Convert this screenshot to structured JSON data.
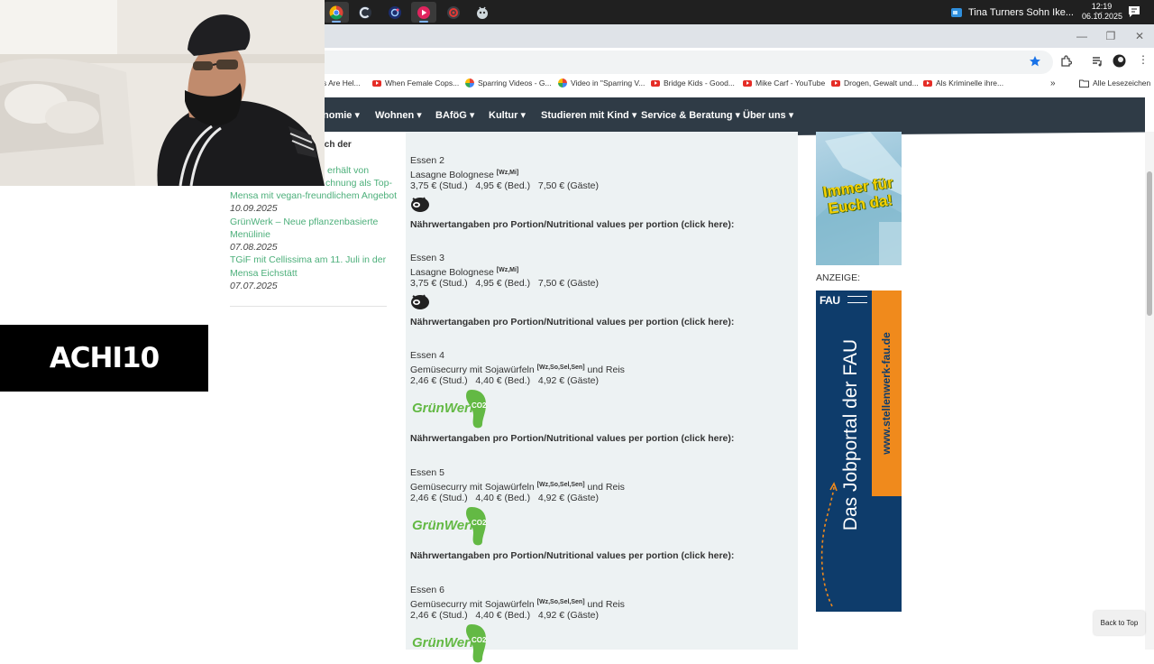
{
  "taskbar": {
    "media_title": "Tina Turners Sohn Ike...",
    "clock_time": "12:19",
    "clock_date": "06.10.2025"
  },
  "bookmarks": [
    {
      "label": "s Are Hel...",
      "icon": "youtube-icon"
    },
    {
      "label": "When Female Cops...",
      "icon": "youtube-icon"
    },
    {
      "label": "Sparring Videos - G...",
      "icon": "google-photos-icon"
    },
    {
      "label": "Video in \"Sparring V...",
      "icon": "google-photos-icon"
    },
    {
      "label": "Bridge Kids - Good...",
      "icon": "youtube-icon"
    },
    {
      "label": "Mike Carf - YouTube",
      "icon": "youtube-icon"
    },
    {
      "label": "Drogen, Gewalt und...",
      "icon": "youtube-icon"
    },
    {
      "label": "Als Kriminelle ihre...",
      "icon": "youtube-icon"
    }
  ],
  "bookmarks_all": "Alle Lesezeichen",
  "nav": {
    "items": [
      {
        "label": "nomie ▾"
      },
      {
        "label": "Wohnen ▾"
      },
      {
        "label": "BAföG ▾"
      },
      {
        "label": "Kultur ▾"
      },
      {
        "label": "Studieren mit Kind ▾"
      },
      {
        "label": "Service & Beratung ▾"
      },
      {
        "label": "Über uns ▾"
      }
    ]
  },
  "sidebar": {
    "partial_1": "ich der",
    "partial_2": "erhält von",
    "partial_3": "chnung als Top-",
    "news": [
      {
        "title": "Mensa mit vegan-freundlichem Angebot",
        "date": "10.09.2025"
      },
      {
        "title": "GrünWerk – Neue pflanzenbasierte Menülinie",
        "date": "07.08.2025"
      },
      {
        "title": "TGiF mit Cellissima am 11. Juli in der Mensa Eichstätt",
        "date": "07.07.2025"
      }
    ]
  },
  "menu": {
    "nutrition_label": "Nährwertangaben pro Portion/Nutritional values per portion (click here):",
    "dishes": [
      {
        "name": "Essen 2",
        "dish": "Lasagne Bolognese",
        "allergens": "[Wz,Mi]",
        "suffix": "",
        "price_student": "3,75 € (Stud.)",
        "price_staff": "4,95 € (Bed.)",
        "price_guest": "7,50 € (Gäste)",
        "badge": "pig-icon"
      },
      {
        "name": "Essen 3",
        "dish": "Lasagne Bolognese",
        "allergens": "[Wz,Mi]",
        "suffix": "",
        "price_student": "3,75 € (Stud.)",
        "price_staff": "4,95 € (Bed.)",
        "price_guest": "7,50 € (Gäste)",
        "badge": "pig-icon"
      },
      {
        "name": "Essen 4",
        "dish": "Gemüsecurry mit Sojawürfeln",
        "allergens": "[Wz,So,Sel,Sen]",
        "suffix": "und Reis",
        "price_student": "2,46 € (Stud.)",
        "price_staff": "4,40 € (Bed.)",
        "price_guest": "4,92 € (Gäste)",
        "badge": "gruenwerk-logo"
      },
      {
        "name": "Essen 5",
        "dish": "Gemüsecurry mit Sojawürfeln",
        "allergens": "[Wz,So,Sel,Sen]",
        "suffix": "und Reis",
        "price_student": "2,46 € (Stud.)",
        "price_staff": "4,40 € (Bed.)",
        "price_guest": "4,92 € (Gäste)",
        "badge": "gruenwerk-logo"
      },
      {
        "name": "Essen 6",
        "dish": "Gemüsecurry mit Sojawürfeln",
        "allergens": "[Wz,So,Sel,Sen]",
        "suffix": "und Reis",
        "price_student": "2,46 € (Stud.)",
        "price_staff": "4,40 € (Bed.)",
        "price_guest": "4,92 € (Gäste)",
        "badge": "gruenwerk-logo"
      }
    ]
  },
  "badges": {
    "gruenwerk_text": "GrünWerk",
    "co2_text": "CO2"
  },
  "ads": {
    "top_banner_text": "Immer für Euch da!",
    "label": "ANZEIGE:",
    "fau_logo": "FAU",
    "fau_headline": "Das Jobportal der FAU",
    "fau_url": "www.stellenwerk-fau.de"
  },
  "overlay": {
    "streamer_logo": "ACHI10"
  },
  "back_to_top": "Back to Top",
  "colors": {
    "nav_bg": "#2f3b46",
    "menu_bg": "#edf2f3",
    "link_green": "#4caf7a",
    "gruenwerk_green": "#63b944",
    "fau_blue": "#0e3c6b",
    "fau_orange": "#f08a1c"
  }
}
